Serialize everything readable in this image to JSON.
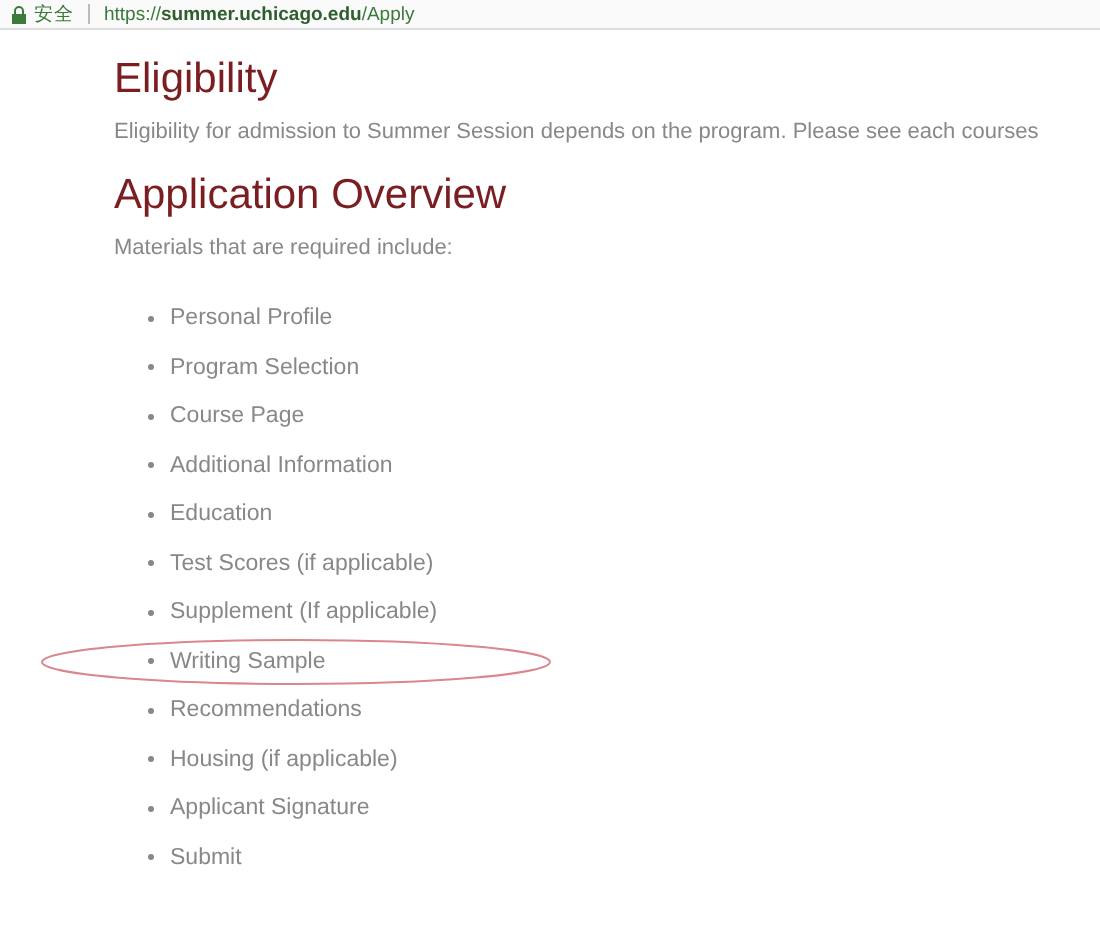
{
  "address_bar": {
    "security_label": "安全",
    "url": "https://**summer.uchicago.edu**/Apply"
  },
  "sections": [
    {
      "heading": "Eligibility",
      "text": "Eligibility for admission to Summer Session depends on the program. Please see each courses"
    },
    {
      "heading": "Application Overview",
      "text": "Materials that are required include:",
      "items": [
        {
          "label": "Personal Profile",
          "circled": false
        },
        {
          "label": "Program Selection",
          "circled": false
        },
        {
          "label": "Course Page",
          "circled": false
        },
        {
          "label": "Additional Information",
          "circled": false
        },
        {
          "label": "Education",
          "circled": false
        },
        {
          "label": "Test Scores (if applicable)",
          "circled": false
        },
        {
          "label": "Supplement (If applicable)",
          "circled": false
        },
        {
          "label": "Writing Sample",
          "circled": true
        },
        {
          "label": "Recommendations",
          "circled": false
        },
        {
          "label": "Housing (if applicable)",
          "circled": false
        },
        {
          "label": "Applicant Signature",
          "circled": false
        },
        {
          "label": "Submit",
          "circled": false
        }
      ]
    }
  ]
}
